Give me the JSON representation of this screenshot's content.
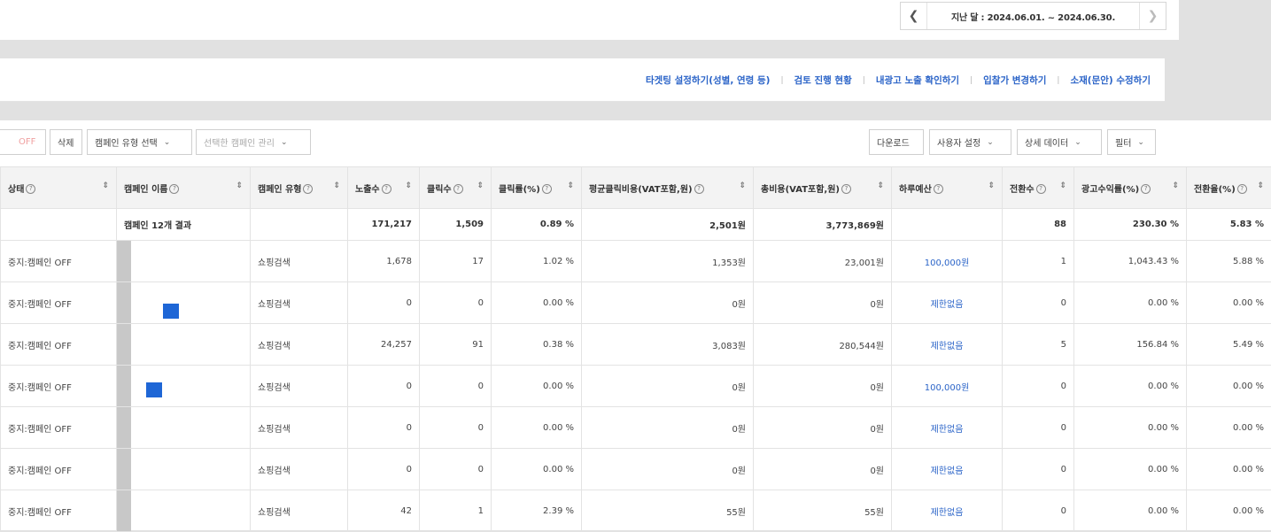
{
  "date_nav": {
    "prev_icon": "chevron-left-icon",
    "label": "지난 달 : 2024.06.01. ~ 2024.06.30.",
    "next_icon": "chevron-right-icon"
  },
  "links": [
    "타겟팅 설정하기(성별, 연령 등)",
    "검토 진행 현황",
    "내광고 노출 확인하기",
    "입찰가 변경하기",
    "소재(문안) 수정하기"
  ],
  "toolbar": {
    "off": "OFF",
    "delete": "삭제",
    "campaign_type_select": "캠페인 유형 선택",
    "manage_selected": "선택한 캠페인 관리",
    "download": "다운로드",
    "user_settings": "사용자 설정",
    "detail_data": "상세 데이터",
    "filter": "필터"
  },
  "columns": [
    "상태",
    "캠페인 이름",
    "캠페인 유형",
    "노출수",
    "클릭수",
    "클릭률(%)",
    "평균클릭비용(VAT포함,원)",
    "총비용(VAT포함,원)",
    "하루예산",
    "전환수",
    "광고수익률(%)",
    "전환율(%)"
  ],
  "summary": {
    "name": "캠페인 12개 결과",
    "impressions": "171,217",
    "clicks": "1,509",
    "ctr": "0.89 %",
    "avg_cpc": "2,501원",
    "total_cost": "3,773,869원",
    "conversions": "88",
    "roas": "230.30 %",
    "cvr": "5.83 %"
  },
  "rows": [
    {
      "status": "중지:캠페인 OFF",
      "type": "쇼핑검색",
      "impressions": "1,678",
      "clicks": "17",
      "ctr": "1.02 %",
      "avg_cpc": "1,353원",
      "total_cost": "23,001원",
      "budget": "100,000원",
      "conversions": "1",
      "roas": "1,043.43 %",
      "cvr": "5.88 %"
    },
    {
      "status": "중지:캠페인 OFF",
      "type": "쇼핑검색",
      "impressions": "0",
      "clicks": "0",
      "ctr": "0.00 %",
      "avg_cpc": "0원",
      "total_cost": "0원",
      "budget": "제한없음",
      "conversions": "0",
      "roas": "0.00 %",
      "cvr": "0.00 %"
    },
    {
      "status": "중지:캠페인 OFF",
      "type": "쇼핑검색",
      "impressions": "24,257",
      "clicks": "91",
      "ctr": "0.38 %",
      "avg_cpc": "3,083원",
      "total_cost": "280,544원",
      "budget": "제한없음",
      "conversions": "5",
      "roas": "156.84 %",
      "cvr": "5.49 %"
    },
    {
      "status": "중지:캠페인 OFF",
      "type": "쇼핑검색",
      "impressions": "0",
      "clicks": "0",
      "ctr": "0.00 %",
      "avg_cpc": "0원",
      "total_cost": "0원",
      "budget": "100,000원",
      "conversions": "0",
      "roas": "0.00 %",
      "cvr": "0.00 %"
    },
    {
      "status": "중지:캠페인 OFF",
      "type": "쇼핑검색",
      "impressions": "0",
      "clicks": "0",
      "ctr": "0.00 %",
      "avg_cpc": "0원",
      "total_cost": "0원",
      "budget": "제한없음",
      "conversions": "0",
      "roas": "0.00 %",
      "cvr": "0.00 %"
    },
    {
      "status": "중지:캠페인 OFF",
      "type": "쇼핑검색",
      "impressions": "0",
      "clicks": "0",
      "ctr": "0.00 %",
      "avg_cpc": "0원",
      "total_cost": "0원",
      "budget": "제한없음",
      "conversions": "0",
      "roas": "0.00 %",
      "cvr": "0.00 %"
    },
    {
      "status": "중지:캠페인 OFF",
      "type": "쇼핑검색",
      "impressions": "42",
      "clicks": "1",
      "ctr": "2.39 %",
      "avg_cpc": "55원",
      "total_cost": "55원",
      "budget": "제한없음",
      "conversions": "0",
      "roas": "0.00 %",
      "cvr": "0.00 %"
    }
  ],
  "colors": {
    "link": "#2b64c8",
    "redacted_block": "#1e66d6",
    "header_bg": "#f3f3f3"
  }
}
